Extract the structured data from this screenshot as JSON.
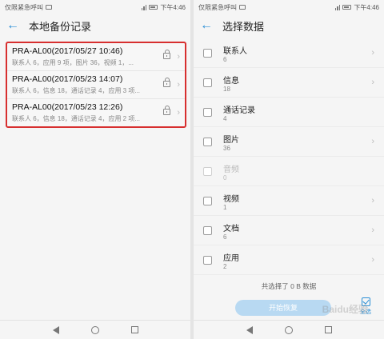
{
  "left": {
    "status": {
      "carrier": "仅限紧急呼叫",
      "time": "下午4:46"
    },
    "title": "本地备份记录",
    "records": [
      {
        "title": "PRA-AL00(2017/05/27 10:46)",
        "detail": "联系人 6，应用 9 项，图片 36，视频 1，..."
      },
      {
        "title": "PRA-AL00(2017/05/23 14:07)",
        "detail": "联系人 6，信息 18，通话记录 4，应用 3 项..."
      },
      {
        "title": "PRA-AL00(2017/05/23 12:26)",
        "detail": "联系人 6，信息 18，通话记录 4，应用 2 项..."
      }
    ]
  },
  "right": {
    "status": {
      "carrier": "仅限紧急呼叫",
      "time": "下午4:46"
    },
    "title": "选择数据",
    "items": [
      {
        "name": "联系人",
        "count": "6"
      },
      {
        "name": "信息",
        "count": "18"
      },
      {
        "name": "通话记录",
        "count": "4"
      },
      {
        "name": "图片",
        "count": "36"
      },
      {
        "name": "音频",
        "count": "0"
      },
      {
        "name": "视频",
        "count": "1"
      },
      {
        "name": "文档",
        "count": "6"
      },
      {
        "name": "应用",
        "count": "2"
      }
    ],
    "summary": "共选择了 0 B 数据",
    "start_label": "开始恢复",
    "select_all_label": "全选"
  },
  "watermark": "Baidu经验",
  "colors": {
    "accent": "#2b8fd6",
    "highlight_border": "#d72f2f"
  }
}
